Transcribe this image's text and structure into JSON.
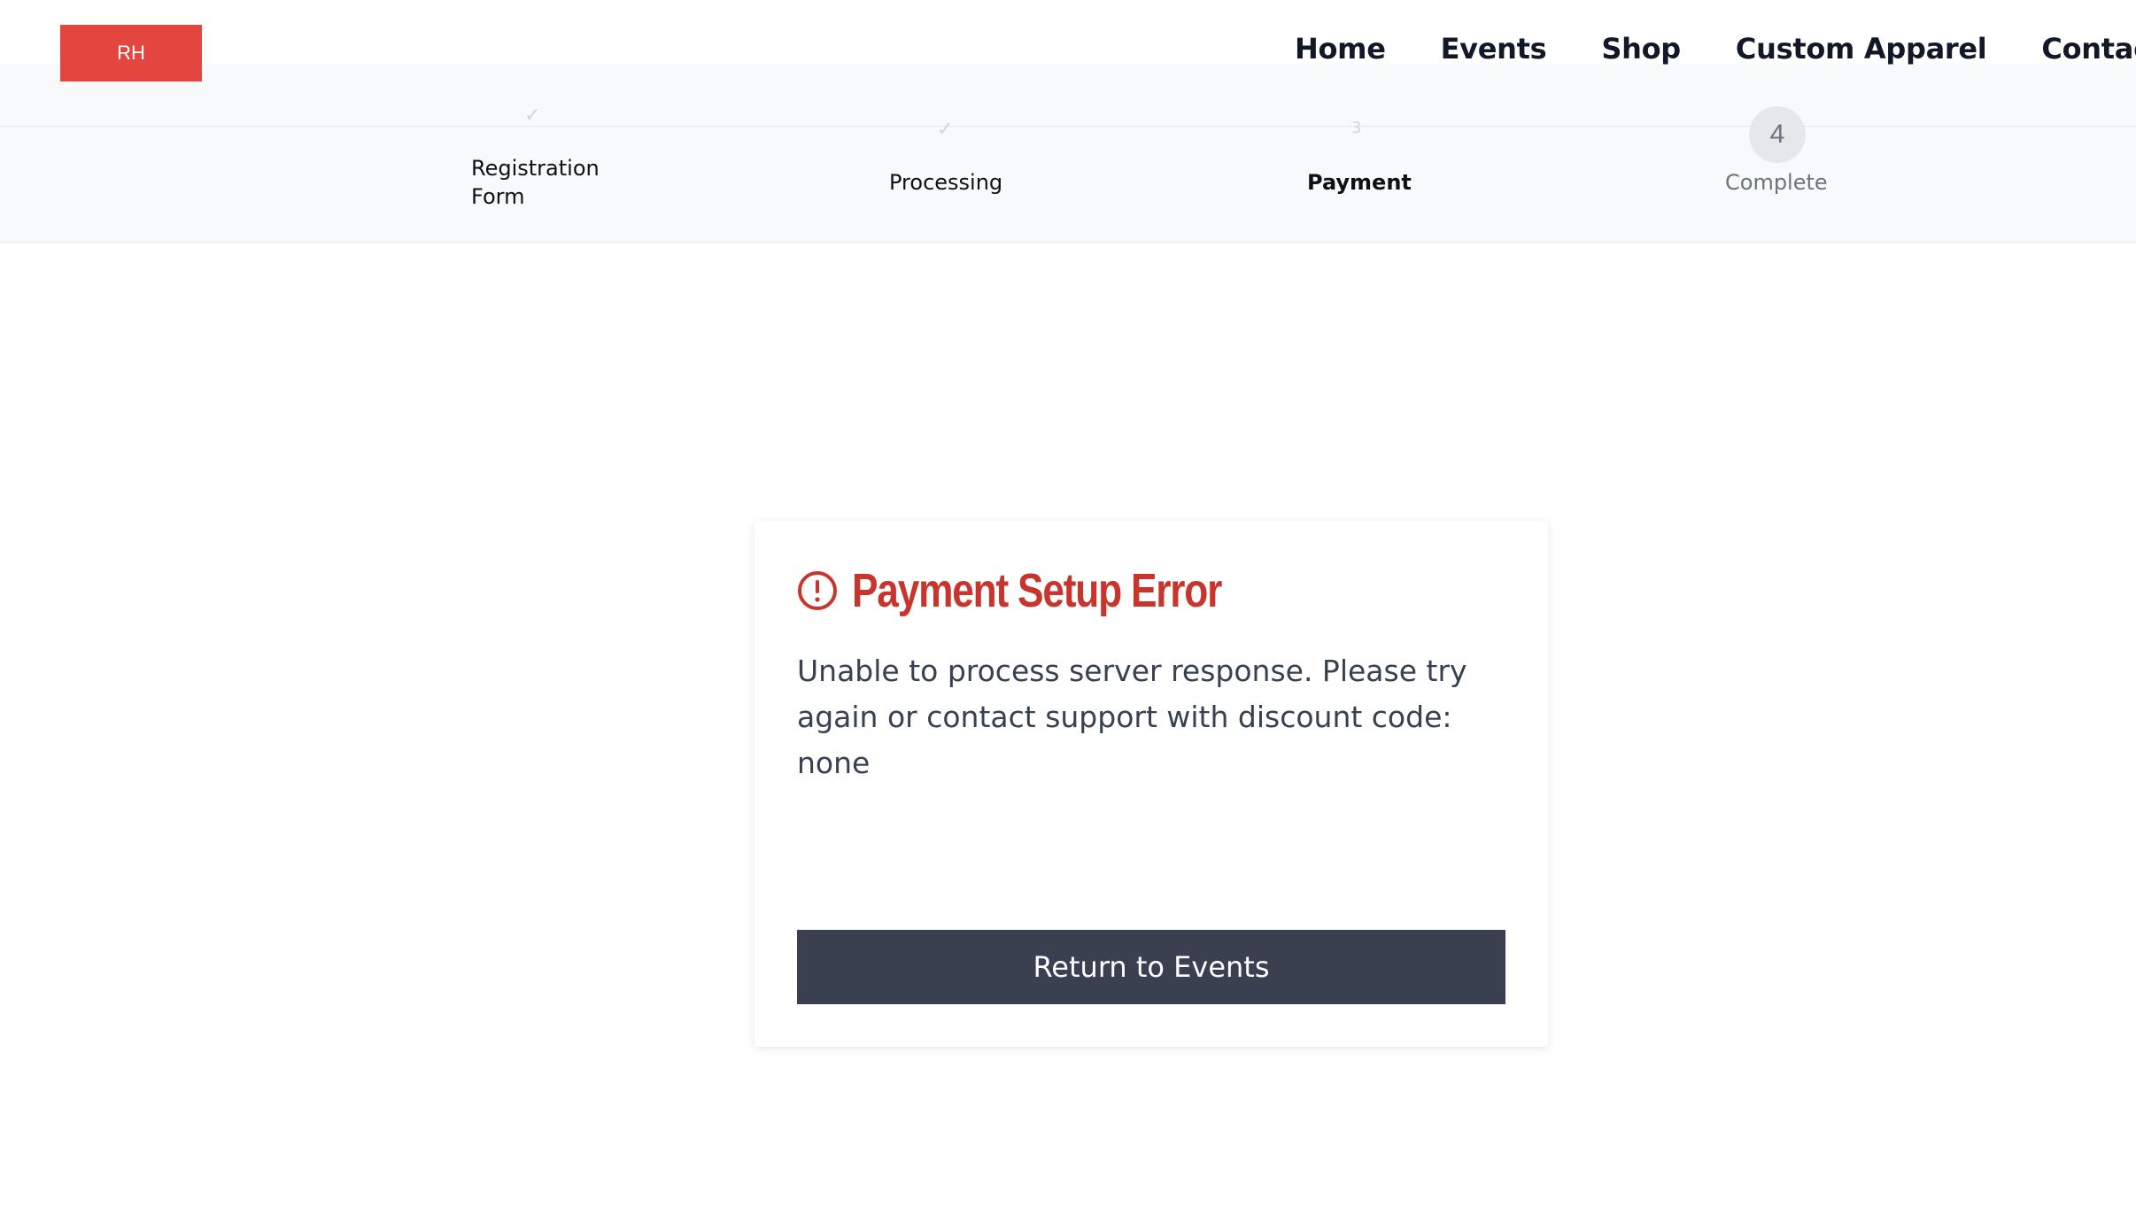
{
  "header": {
    "logo_text": "RH",
    "nav": [
      "Home",
      "Events",
      "Shop",
      "Custom Apparel",
      "Contact"
    ]
  },
  "steps": [
    {
      "label": "Registration Form",
      "marker": "✓",
      "state": "done"
    },
    {
      "label": "Processing",
      "marker": "✓",
      "state": "done"
    },
    {
      "label": "Payment",
      "marker": "3",
      "state": "current"
    },
    {
      "label": "Complete",
      "marker": "4",
      "state": "future"
    }
  ],
  "error_card": {
    "title": "Payment Setup Error",
    "message": "Unable to process server response. Please try again or contact support with discount code: none",
    "button_label": "Return to Events"
  },
  "colors": {
    "brand_red": "#e2463f",
    "error_red": "#c8352d",
    "button_dark": "#3a4050"
  }
}
